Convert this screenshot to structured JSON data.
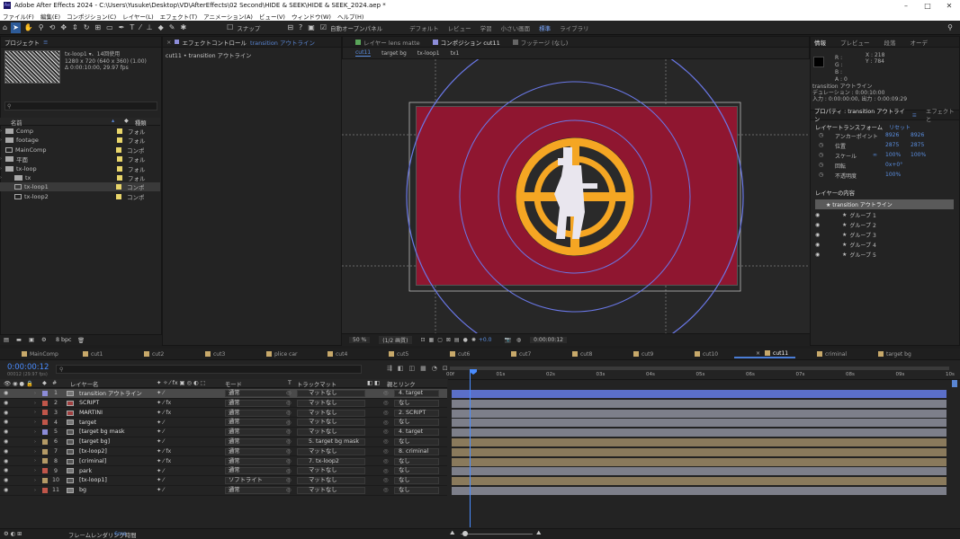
{
  "titlebar": {
    "app_logo": "Ae",
    "title": "Adobe After Effects 2024 - C:\\Users\\Yusuke\\Desktop\\VD\\AfterEffects\\02 Second\\HIDE & SEEK\\HIDE & SEEK_2024.aep *"
  },
  "menu": [
    "ファイル(F)",
    "編集(E)",
    "コンポジション(C)",
    "レイヤー(L)",
    "エフェクト(T)",
    "アニメーション(A)",
    "ビュー(V)",
    "ウィンドウ(W)",
    "ヘルプ(H)"
  ],
  "toolbar": {
    "snap_label": "スナップ",
    "auto_open_label": "自動オープンパネル",
    "workspaces": [
      "デフォルト",
      "レビュー",
      "学習",
      "小さい画面",
      "標準",
      "ライブラリ"
    ],
    "active_workspace_index": 4
  },
  "project": {
    "tab_label": "プロジェクト",
    "selected_item_name": "tx-loop1 ▾、14回使用",
    "selected_item_dims": "1280 x 720 (640 x 360) (1.00)",
    "selected_item_duration": "Δ 0:00:10:00, 29.97 fps",
    "col_name": "名前",
    "col_type": "種類",
    "items": [
      {
        "name": "Comp",
        "type": "フォル",
        "kind": "folder",
        "color": "#e8d56a",
        "indent": 0
      },
      {
        "name": "footage",
        "type": "フォル",
        "kind": "folder",
        "color": "#e8d56a",
        "indent": 0
      },
      {
        "name": "MainComp",
        "type": "コンポ",
        "kind": "comp",
        "color": "#e8d56a",
        "indent": 0
      },
      {
        "name": "平面",
        "type": "フォル",
        "kind": "folder",
        "color": "#e8d56a",
        "indent": 0
      },
      {
        "name": "tx-loop",
        "type": "フォル",
        "kind": "folder",
        "color": "#e8d56a",
        "indent": 0
      },
      {
        "name": "tx",
        "type": "フォル",
        "kind": "folder",
        "color": "#e8d56a",
        "indent": 1
      },
      {
        "name": "tx-loop1",
        "type": "コンポ",
        "kind": "comp",
        "color": "#e8d56a",
        "indent": 1,
        "selected": true
      },
      {
        "name": "tx-loop2",
        "type": "コンポ",
        "kind": "comp",
        "color": "#e8d56a",
        "indent": 1
      }
    ],
    "bpc": "8 bpc"
  },
  "effect_controls": {
    "tab_label": "エフェクトコントロール",
    "tab_target": "transition アウトライン",
    "breadcrumb": "cut11 • transition アウトライン"
  },
  "composition": {
    "tabs": [
      {
        "label": "レイヤー lens matte",
        "active": false
      },
      {
        "label": "コンポジション cut11",
        "active": true
      },
      {
        "label": "フッテージ (なし)",
        "active": false
      }
    ],
    "breadcrumbs": [
      "cut11",
      "target bg",
      "tx-loop1",
      "tx1"
    ],
    "zoom": "50 %",
    "resolution": "(1/2 画質)",
    "exposure": "+0.0",
    "timecode": "0:00:00:12",
    "bg_color": "#8f1630",
    "target_ring_color": "#f5a623"
  },
  "info": {
    "tabs": [
      "情報",
      "プレビュー",
      "段落",
      "オーデ"
    ],
    "r": "R :",
    "g": "G :",
    "b": "B :",
    "a": "A : 0",
    "x": "X : 218",
    "y": "Y : 784",
    "layer_name": "transition アウトライン",
    "duration": "デュレーション : 0:00:10:00",
    "in_out": "入力 : 0:00:00:00, 出力 : 0:00:09:29"
  },
  "properties": {
    "tab_label": "プロパティ : transition アウトライン",
    "tab2_label": "エフェクトと",
    "section_transform": "レイヤートランスフォーム",
    "reset_label": "リセット",
    "rows": [
      {
        "label": "アンカーポイント",
        "v1": "8926",
        "v2": "8926"
      },
      {
        "label": "位置",
        "v1": "2875",
        "v2": "2875"
      },
      {
        "label": "スケール",
        "v1": "100%",
        "v2": "100%"
      },
      {
        "label": "回転",
        "v1": "0x+0°",
        "v2": ""
      },
      {
        "label": "不透明度",
        "v1": "100%",
        "v2": ""
      }
    ],
    "section_contents": "レイヤーの内容",
    "contents_root": "★ transition アウトライン",
    "groups": [
      "グループ 1",
      "グループ 2",
      "グループ 3",
      "グループ 4",
      "グループ 5"
    ]
  },
  "timeline": {
    "tabs": [
      {
        "label": "MainComp",
        "color": "#c8a96a",
        "active": false
      },
      {
        "label": "cut1",
        "color": "#c8a96a",
        "active": false
      },
      {
        "label": "cut2",
        "color": "#c8a96a",
        "active": false
      },
      {
        "label": "cut3",
        "color": "#c8a96a",
        "active": false
      },
      {
        "label": "plice car",
        "color": "#c8a96a",
        "active": false
      },
      {
        "label": "cut4",
        "color": "#c8a96a",
        "active": false
      },
      {
        "label": "cut5",
        "color": "#c8a96a",
        "active": false
      },
      {
        "label": "cut6",
        "color": "#c8a96a",
        "active": false
      },
      {
        "label": "cut7",
        "color": "#c8a96a",
        "active": false
      },
      {
        "label": "cut8",
        "color": "#c8a96a",
        "active": false
      },
      {
        "label": "cut9",
        "color": "#c8a96a",
        "active": false
      },
      {
        "label": "cut10",
        "color": "#c8a96a",
        "active": false
      },
      {
        "label": "cut11",
        "color": "#c8a96a",
        "active": true
      },
      {
        "label": "criminal",
        "color": "#c8a96a",
        "active": false
      },
      {
        "label": "target bg",
        "color": "#c8a96a",
        "active": false
      }
    ],
    "timecode": "0:00:00:12",
    "fps_info": "00012 (29.97 fps)",
    "col_layer_name": "レイヤー名",
    "col_mode": "モード",
    "col_trkmat": "トラックマット",
    "col_parent": "親とリンク",
    "ruler": [
      "00f",
      "01s",
      "02s",
      "03s",
      "04s",
      "05s",
      "06s",
      "07s",
      "08s",
      "09s",
      "10s"
    ],
    "playhead_time": 0.4,
    "duration": 10,
    "layers": [
      {
        "num": "1",
        "name": "transition アウトライン",
        "label_color": "#8c8cd8",
        "kind": "shape",
        "mode": "通常",
        "trkmat": "マットなし",
        "parent": "4. target",
        "bar_color": "#5b6fc8",
        "selected": true,
        "sw": "✦ ⁄"
      },
      {
        "num": "2",
        "name": "SCRIPT",
        "label_color": "#c0564a",
        "kind": "text",
        "mode": "通常",
        "trkmat": "マットなし",
        "parent": "なし",
        "bar_color": "#7d7f8a",
        "sw": "✦ ⁄ fx"
      },
      {
        "num": "3",
        "name": "MARTINI",
        "label_color": "#c0564a",
        "kind": "text",
        "mode": "通常",
        "trkmat": "マットなし",
        "parent": "2. SCRIPT",
        "bar_color": "#7d7f8a",
        "sw": "✦ ⁄ fx"
      },
      {
        "num": "4",
        "name": "target",
        "label_color": "#c0564a",
        "kind": "shape",
        "mode": "通常",
        "trkmat": "マットなし",
        "parent": "なし",
        "bar_color": "#7d7f8a",
        "sw": "✦ ⁄"
      },
      {
        "num": "5",
        "name": "[target bg mask",
        "label_color": "#8c8cd8",
        "kind": "comp",
        "mode": "通常",
        "trkmat": "マットなし",
        "parent": "4. target",
        "bar_color": "#7d7f8a",
        "sw": "✦ ⁄"
      },
      {
        "num": "6",
        "name": "[target bg]",
        "label_color": "#b49a66",
        "kind": "comp",
        "mode": "通常",
        "trkmat": "5. target bg mask",
        "parent": "なし",
        "bar_color": "#8a7a5c",
        "sw": "✦ ⁄"
      },
      {
        "num": "7",
        "name": "[tx-loop2]",
        "label_color": "#b49a66",
        "kind": "comp",
        "mode": "通常",
        "trkmat": "マットなし",
        "parent": "8. criminal",
        "bar_color": "#8a7a5c",
        "sw": "✦ ⁄ fx"
      },
      {
        "num": "8",
        "name": "[criminal]",
        "label_color": "#b49a66",
        "kind": "comp",
        "mode": "通常",
        "trkmat": "7. tx-loop2",
        "parent": "なし",
        "bar_color": "#8a7a5c",
        "sw": "✦ ⁄ fx"
      },
      {
        "num": "9",
        "name": "park",
        "label_color": "#c0564a",
        "kind": "shape",
        "mode": "通常",
        "trkmat": "マットなし",
        "parent": "なし",
        "bar_color": "#7d7f8a",
        "sw": "✦ ⁄"
      },
      {
        "num": "10",
        "name": "[tx-loop1]",
        "label_color": "#b49a66",
        "kind": "comp",
        "mode": "ソフトライト",
        "trkmat": "マットなし",
        "parent": "なし",
        "bar_color": "#8a7a5c",
        "sw": "✦ ⁄"
      },
      {
        "num": "11",
        "name": "bg",
        "label_color": "#c0564a",
        "kind": "shape",
        "mode": "通常",
        "trkmat": "マットなし",
        "parent": "なし",
        "bar_color": "#7d7f8a",
        "sw": "✦ ⁄"
      }
    ],
    "render_time_label": "フレームレンダリング時間",
    "render_time_value": "6ms"
  }
}
